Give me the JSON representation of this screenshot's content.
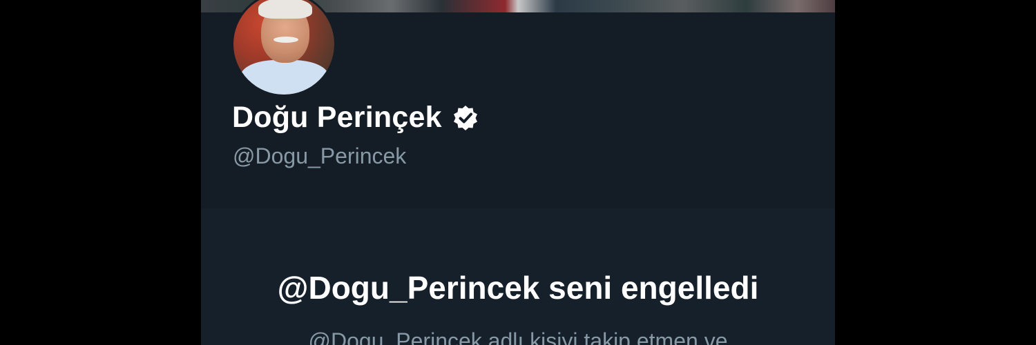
{
  "profile": {
    "display_name": "Doğu Perinçek",
    "handle": "@Dogu_Perincek",
    "verified": true,
    "avatar_alt": "profile photo"
  },
  "blocked": {
    "title": "@Dogu_Perincek seni engelledi",
    "body": "@Dogu_Perincek adlı kişiyi takip etmen ve"
  },
  "colors": {
    "background": "#000000",
    "profile_header": "#141d26",
    "panel": "#16202b",
    "primary_text": "#ffffff",
    "secondary_text": "#8899a6"
  },
  "icons": {
    "verified": "verified-badge-icon"
  }
}
